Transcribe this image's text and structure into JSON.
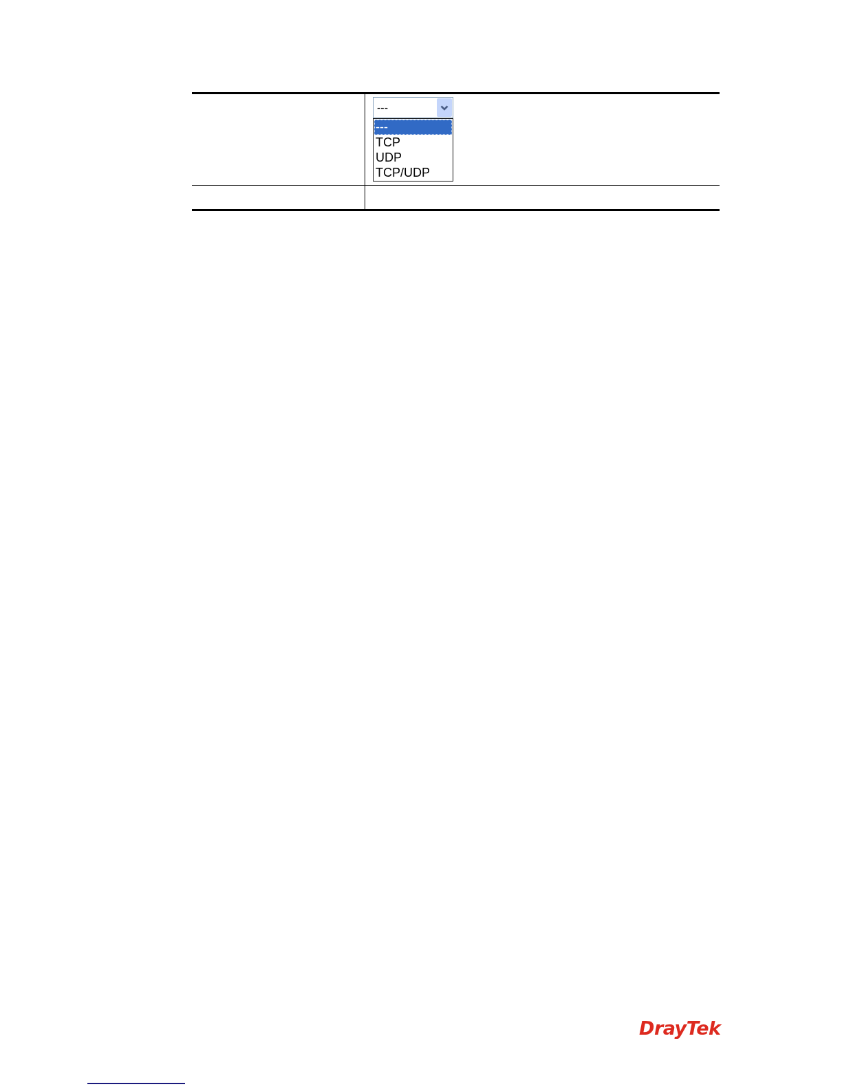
{
  "table": {
    "rows": [
      {
        "kind": "dropdown",
        "dropdown": {
          "value": "---",
          "expanded": true,
          "options": [
            {
              "label": "---",
              "selected": true
            },
            {
              "label": "TCP",
              "selected": false
            },
            {
              "label": "UDP",
              "selected": false
            },
            {
              "label": "TCP/UDP",
              "selected": false
            }
          ]
        }
      },
      {
        "kind": "blank"
      }
    ]
  },
  "footer": {
    "logo": "DrayTek"
  }
}
